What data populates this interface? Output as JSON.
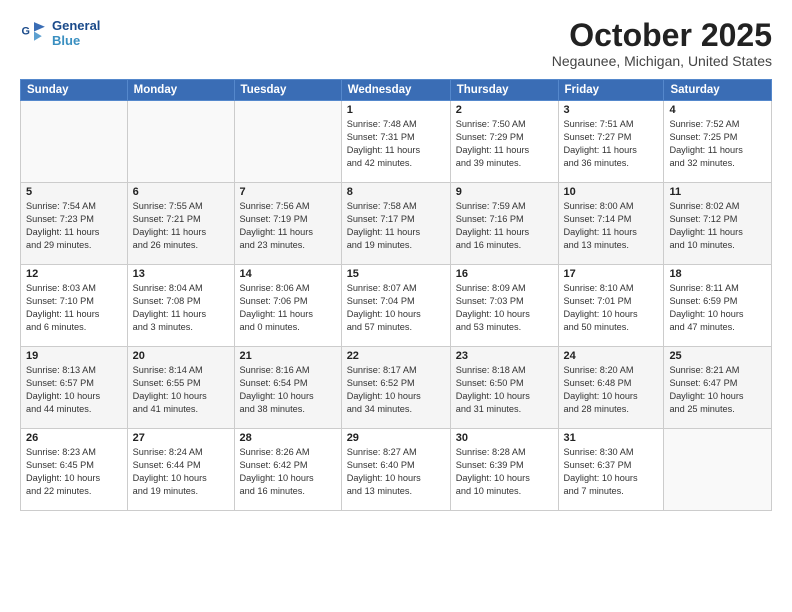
{
  "logo": {
    "line1": "General",
    "line2": "Blue"
  },
  "title": "October 2025",
  "location": "Negaunee, Michigan, United States",
  "weekdays": [
    "Sunday",
    "Monday",
    "Tuesday",
    "Wednesday",
    "Thursday",
    "Friday",
    "Saturday"
  ],
  "weeks": [
    [
      {
        "day": "",
        "info": ""
      },
      {
        "day": "",
        "info": ""
      },
      {
        "day": "",
        "info": ""
      },
      {
        "day": "1",
        "info": "Sunrise: 7:48 AM\nSunset: 7:31 PM\nDaylight: 11 hours\nand 42 minutes."
      },
      {
        "day": "2",
        "info": "Sunrise: 7:50 AM\nSunset: 7:29 PM\nDaylight: 11 hours\nand 39 minutes."
      },
      {
        "day": "3",
        "info": "Sunrise: 7:51 AM\nSunset: 7:27 PM\nDaylight: 11 hours\nand 36 minutes."
      },
      {
        "day": "4",
        "info": "Sunrise: 7:52 AM\nSunset: 7:25 PM\nDaylight: 11 hours\nand 32 minutes."
      }
    ],
    [
      {
        "day": "5",
        "info": "Sunrise: 7:54 AM\nSunset: 7:23 PM\nDaylight: 11 hours\nand 29 minutes."
      },
      {
        "day": "6",
        "info": "Sunrise: 7:55 AM\nSunset: 7:21 PM\nDaylight: 11 hours\nand 26 minutes."
      },
      {
        "day": "7",
        "info": "Sunrise: 7:56 AM\nSunset: 7:19 PM\nDaylight: 11 hours\nand 23 minutes."
      },
      {
        "day": "8",
        "info": "Sunrise: 7:58 AM\nSunset: 7:17 PM\nDaylight: 11 hours\nand 19 minutes."
      },
      {
        "day": "9",
        "info": "Sunrise: 7:59 AM\nSunset: 7:16 PM\nDaylight: 11 hours\nand 16 minutes."
      },
      {
        "day": "10",
        "info": "Sunrise: 8:00 AM\nSunset: 7:14 PM\nDaylight: 11 hours\nand 13 minutes."
      },
      {
        "day": "11",
        "info": "Sunrise: 8:02 AM\nSunset: 7:12 PM\nDaylight: 11 hours\nand 10 minutes."
      }
    ],
    [
      {
        "day": "12",
        "info": "Sunrise: 8:03 AM\nSunset: 7:10 PM\nDaylight: 11 hours\nand 6 minutes."
      },
      {
        "day": "13",
        "info": "Sunrise: 8:04 AM\nSunset: 7:08 PM\nDaylight: 11 hours\nand 3 minutes."
      },
      {
        "day": "14",
        "info": "Sunrise: 8:06 AM\nSunset: 7:06 PM\nDaylight: 11 hours\nand 0 minutes."
      },
      {
        "day": "15",
        "info": "Sunrise: 8:07 AM\nSunset: 7:04 PM\nDaylight: 10 hours\nand 57 minutes."
      },
      {
        "day": "16",
        "info": "Sunrise: 8:09 AM\nSunset: 7:03 PM\nDaylight: 10 hours\nand 53 minutes."
      },
      {
        "day": "17",
        "info": "Sunrise: 8:10 AM\nSunset: 7:01 PM\nDaylight: 10 hours\nand 50 minutes."
      },
      {
        "day": "18",
        "info": "Sunrise: 8:11 AM\nSunset: 6:59 PM\nDaylight: 10 hours\nand 47 minutes."
      }
    ],
    [
      {
        "day": "19",
        "info": "Sunrise: 8:13 AM\nSunset: 6:57 PM\nDaylight: 10 hours\nand 44 minutes."
      },
      {
        "day": "20",
        "info": "Sunrise: 8:14 AM\nSunset: 6:55 PM\nDaylight: 10 hours\nand 41 minutes."
      },
      {
        "day": "21",
        "info": "Sunrise: 8:16 AM\nSunset: 6:54 PM\nDaylight: 10 hours\nand 38 minutes."
      },
      {
        "day": "22",
        "info": "Sunrise: 8:17 AM\nSunset: 6:52 PM\nDaylight: 10 hours\nand 34 minutes."
      },
      {
        "day": "23",
        "info": "Sunrise: 8:18 AM\nSunset: 6:50 PM\nDaylight: 10 hours\nand 31 minutes."
      },
      {
        "day": "24",
        "info": "Sunrise: 8:20 AM\nSunset: 6:48 PM\nDaylight: 10 hours\nand 28 minutes."
      },
      {
        "day": "25",
        "info": "Sunrise: 8:21 AM\nSunset: 6:47 PM\nDaylight: 10 hours\nand 25 minutes."
      }
    ],
    [
      {
        "day": "26",
        "info": "Sunrise: 8:23 AM\nSunset: 6:45 PM\nDaylight: 10 hours\nand 22 minutes."
      },
      {
        "day": "27",
        "info": "Sunrise: 8:24 AM\nSunset: 6:44 PM\nDaylight: 10 hours\nand 19 minutes."
      },
      {
        "day": "28",
        "info": "Sunrise: 8:26 AM\nSunset: 6:42 PM\nDaylight: 10 hours\nand 16 minutes."
      },
      {
        "day": "29",
        "info": "Sunrise: 8:27 AM\nSunset: 6:40 PM\nDaylight: 10 hours\nand 13 minutes."
      },
      {
        "day": "30",
        "info": "Sunrise: 8:28 AM\nSunset: 6:39 PM\nDaylight: 10 hours\nand 10 minutes."
      },
      {
        "day": "31",
        "info": "Sunrise: 8:30 AM\nSunset: 6:37 PM\nDaylight: 10 hours\nand 7 minutes."
      },
      {
        "day": "",
        "info": ""
      }
    ]
  ]
}
